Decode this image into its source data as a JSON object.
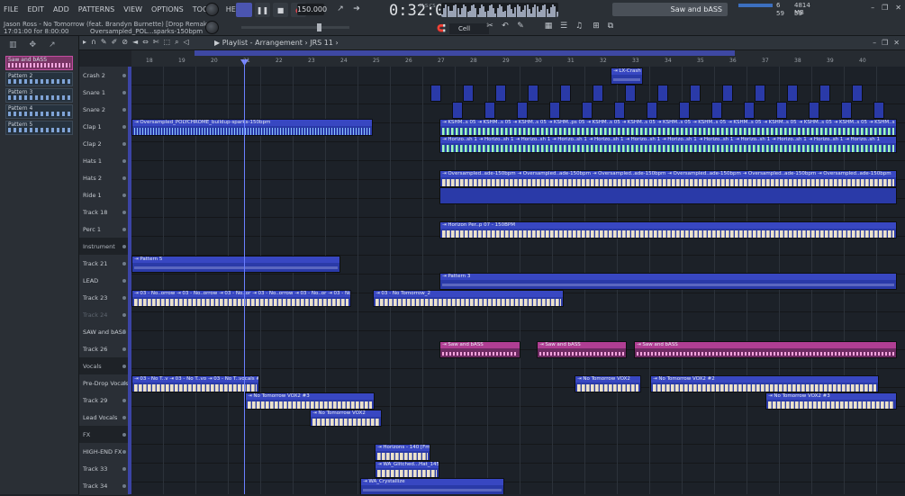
{
  "menu": [
    "FILE",
    "EDIT",
    "ADD",
    "PATTERNS",
    "VIEW",
    "OPTIONS",
    "TOOLS",
    "HELP"
  ],
  "song": {
    "title": "Jason Ross - No Tomorrow (feat. Brandyn Burnette) [Drop Remake]",
    "hint": "17:01:00 for 8:00:00",
    "hint2": "Oversampled_POL...sparks-150bpm"
  },
  "transport": {
    "tempo": "150.000",
    "time": "0:32:00",
    "time_unit": "M:S:CS"
  },
  "toolbar": {
    "snap": "Cell",
    "hint_panel": "Saw and bASS",
    "cpu_top": "6",
    "cpu_bottom": "59",
    "ram_top": "4814 MB",
    "ram_bottom": "59"
  },
  "playlist": {
    "title": "Playlist - Arrangement",
    "breadcrumb": "JRS 11"
  },
  "patterns": [
    "Saw and bASS",
    "Pattern 2",
    "Pattern 3",
    "Pattern 4",
    "Pattern 5"
  ],
  "ruler": [
    "18",
    "19",
    "20",
    "21",
    "22",
    "23",
    "24",
    "25",
    "26",
    "27",
    "28",
    "29",
    "30",
    "31",
    "32",
    "33",
    "34",
    "35",
    "36",
    "37",
    "38",
    "39",
    "40"
  ],
  "tracks": [
    {
      "name": "Crash 2"
    },
    {
      "name": "Snare 1"
    },
    {
      "name": "Snare 2"
    },
    {
      "name": "Clap 1"
    },
    {
      "name": "Clap 2"
    },
    {
      "name": "Hats 1"
    },
    {
      "name": "Hats 2"
    },
    {
      "name": "Ride 1"
    },
    {
      "name": "Track 18"
    },
    {
      "name": "Perc 1"
    },
    {
      "name": "Instrument"
    },
    {
      "name": "Track 21"
    },
    {
      "name": "LEAD"
    },
    {
      "name": "Track 23"
    },
    {
      "name": "Track 24"
    },
    {
      "name": "SAW and bASS"
    },
    {
      "name": "Track 26"
    },
    {
      "name": "Vocals"
    },
    {
      "name": "Pre-Drop Vocals"
    },
    {
      "name": "Track 29"
    },
    {
      "name": "Lead Vocals"
    },
    {
      "name": "FX"
    },
    {
      "name": "HIGH-END FX"
    },
    {
      "name": "Track 33"
    },
    {
      "name": "Track 34"
    }
  ],
  "clips": {
    "crash": "LX-Crash",
    "clap1a": "Oversampled_POLYCHROME_buildup-sparks-150bpm",
    "clap1b": "KSHM..s 05 ⇥ KSHM..s 05 ⇥ KSHM..s 05 ⇥ KSHM..ps 05 ⇥ KSHM..s 05 ⇥ KSHM..s 05 ⇥ KSHM..s 05 ⇥ KSHM..s 05 ⇥ KSHM..s 05 ⇥ KSHM..s 05 ⇥ KSHM..s 05 ⇥ KSHM..s 05 ⇥ KSHM..s 05 ⇥ KSHM..s 05",
    "clap2": "Horizo..sh 1 ⇥ Horizo..sh 1 ⇥ Horizo..sh 1 ⇥ Horizo..sh 1 ⇥ Horizo..sh 1 ⇥ Horizo..sh 1 ⇥ Horizo..sh 1 ⇥ Horizo..sh 1 ⇥ Horizo..sh 1 ⇥ Horizo..sh 1 ⇥ Horizo..sh 1 ⇥ Horizo..sh 1",
    "hats2": "Oversampled..ade-150bpm ⇥ Oversampled..ade-150bpm ⇥ Oversampled..ade-150bpm ⇥ Oversampled..ade-150bpm ⇥ Oversampled..ade-150bpm ⇥ Oversampled..ade-150bpm",
    "perc1a": "Horizon Per..p 07 - 150BPM",
    "perc1b": "Horizon Perc Loop 07 - 150BPM",
    "perc1c": "Horizon Perc Loop 07 - 150BPM",
    "perc1d": "Horizon Perc Loop 07 - 150BPM",
    "track21": "Pattern 5",
    "lead": "Pattern 3",
    "track23a": "03 - No..orrow ⇥ 03 - No..orrow ⇥ 03 - No..or ⇥ 03 - No..orrow ⇥ 03 - No..or ⇥ 03 - No..orrow_2",
    "track23b": "03 - No Tomorrow_2",
    "saw1": "Saw and bASS",
    "saw2": "Saw and bASS",
    "saw3": "Saw and bASS",
    "predrop": "03 - No T..v ⇥ 03 - No T..vo ⇥ 03 - No T..vocals #6",
    "predrop2": "No Tomorrow VOX2",
    "predrop3": "No Tomorrow VOX2 #2",
    "t29a": "No Tomorrow VOX2 #3",
    "t29b": "No Tomorrow VOX2 #3",
    "leadvox": "No Tomorrow VOX2",
    "highfx": "Horizons - 140 [Fmaj]",
    "t33": "WA_Glitched...Hat_145BPM",
    "t34": "WA_Crystallize"
  },
  "colors": {
    "accent": "#3847c2",
    "pink": "#b03e93",
    "playhead": "#6b80ff",
    "bg": "#1c2128"
  }
}
